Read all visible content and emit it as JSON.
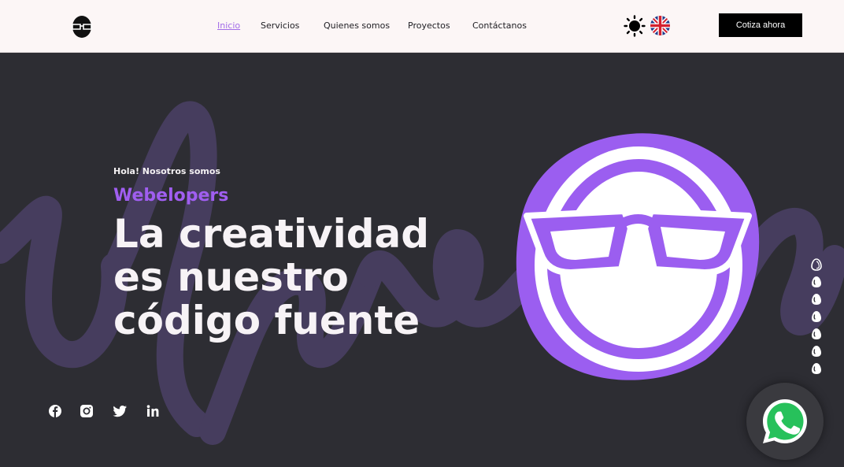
{
  "header": {
    "nav": [
      {
        "label": "Inicio",
        "active": true
      },
      {
        "label": "Servicios",
        "active": false
      },
      {
        "label": "Quienes somos",
        "active": false
      },
      {
        "label": "Proyectos",
        "active": false
      },
      {
        "label": "Contáctanos",
        "active": false
      }
    ],
    "cta_label": "Cotiza ahora",
    "icons": {
      "logo": "egg-glasses-logo",
      "theme": "sun-icon",
      "language": "uk-flag-icon"
    }
  },
  "hero": {
    "kicker": "Hola! Nosotros somos",
    "brand": "Webelopers",
    "headline": [
      "La creatividad",
      "es nuestro",
      "código fuente"
    ],
    "side_nav_count": 7,
    "socials": [
      "facebook-icon",
      "instagram-icon",
      "twitter-icon",
      "linkedin-icon"
    ],
    "whatsapp_icon": "whatsapp-icon"
  },
  "colors": {
    "header_bg": "#fcf6f6",
    "hero_bg": "#2d2d33",
    "accent": "#a05ef0",
    "script_bg": "#463d5e",
    "text_light": "#f7f3f6",
    "cta_bg": "#000000"
  }
}
